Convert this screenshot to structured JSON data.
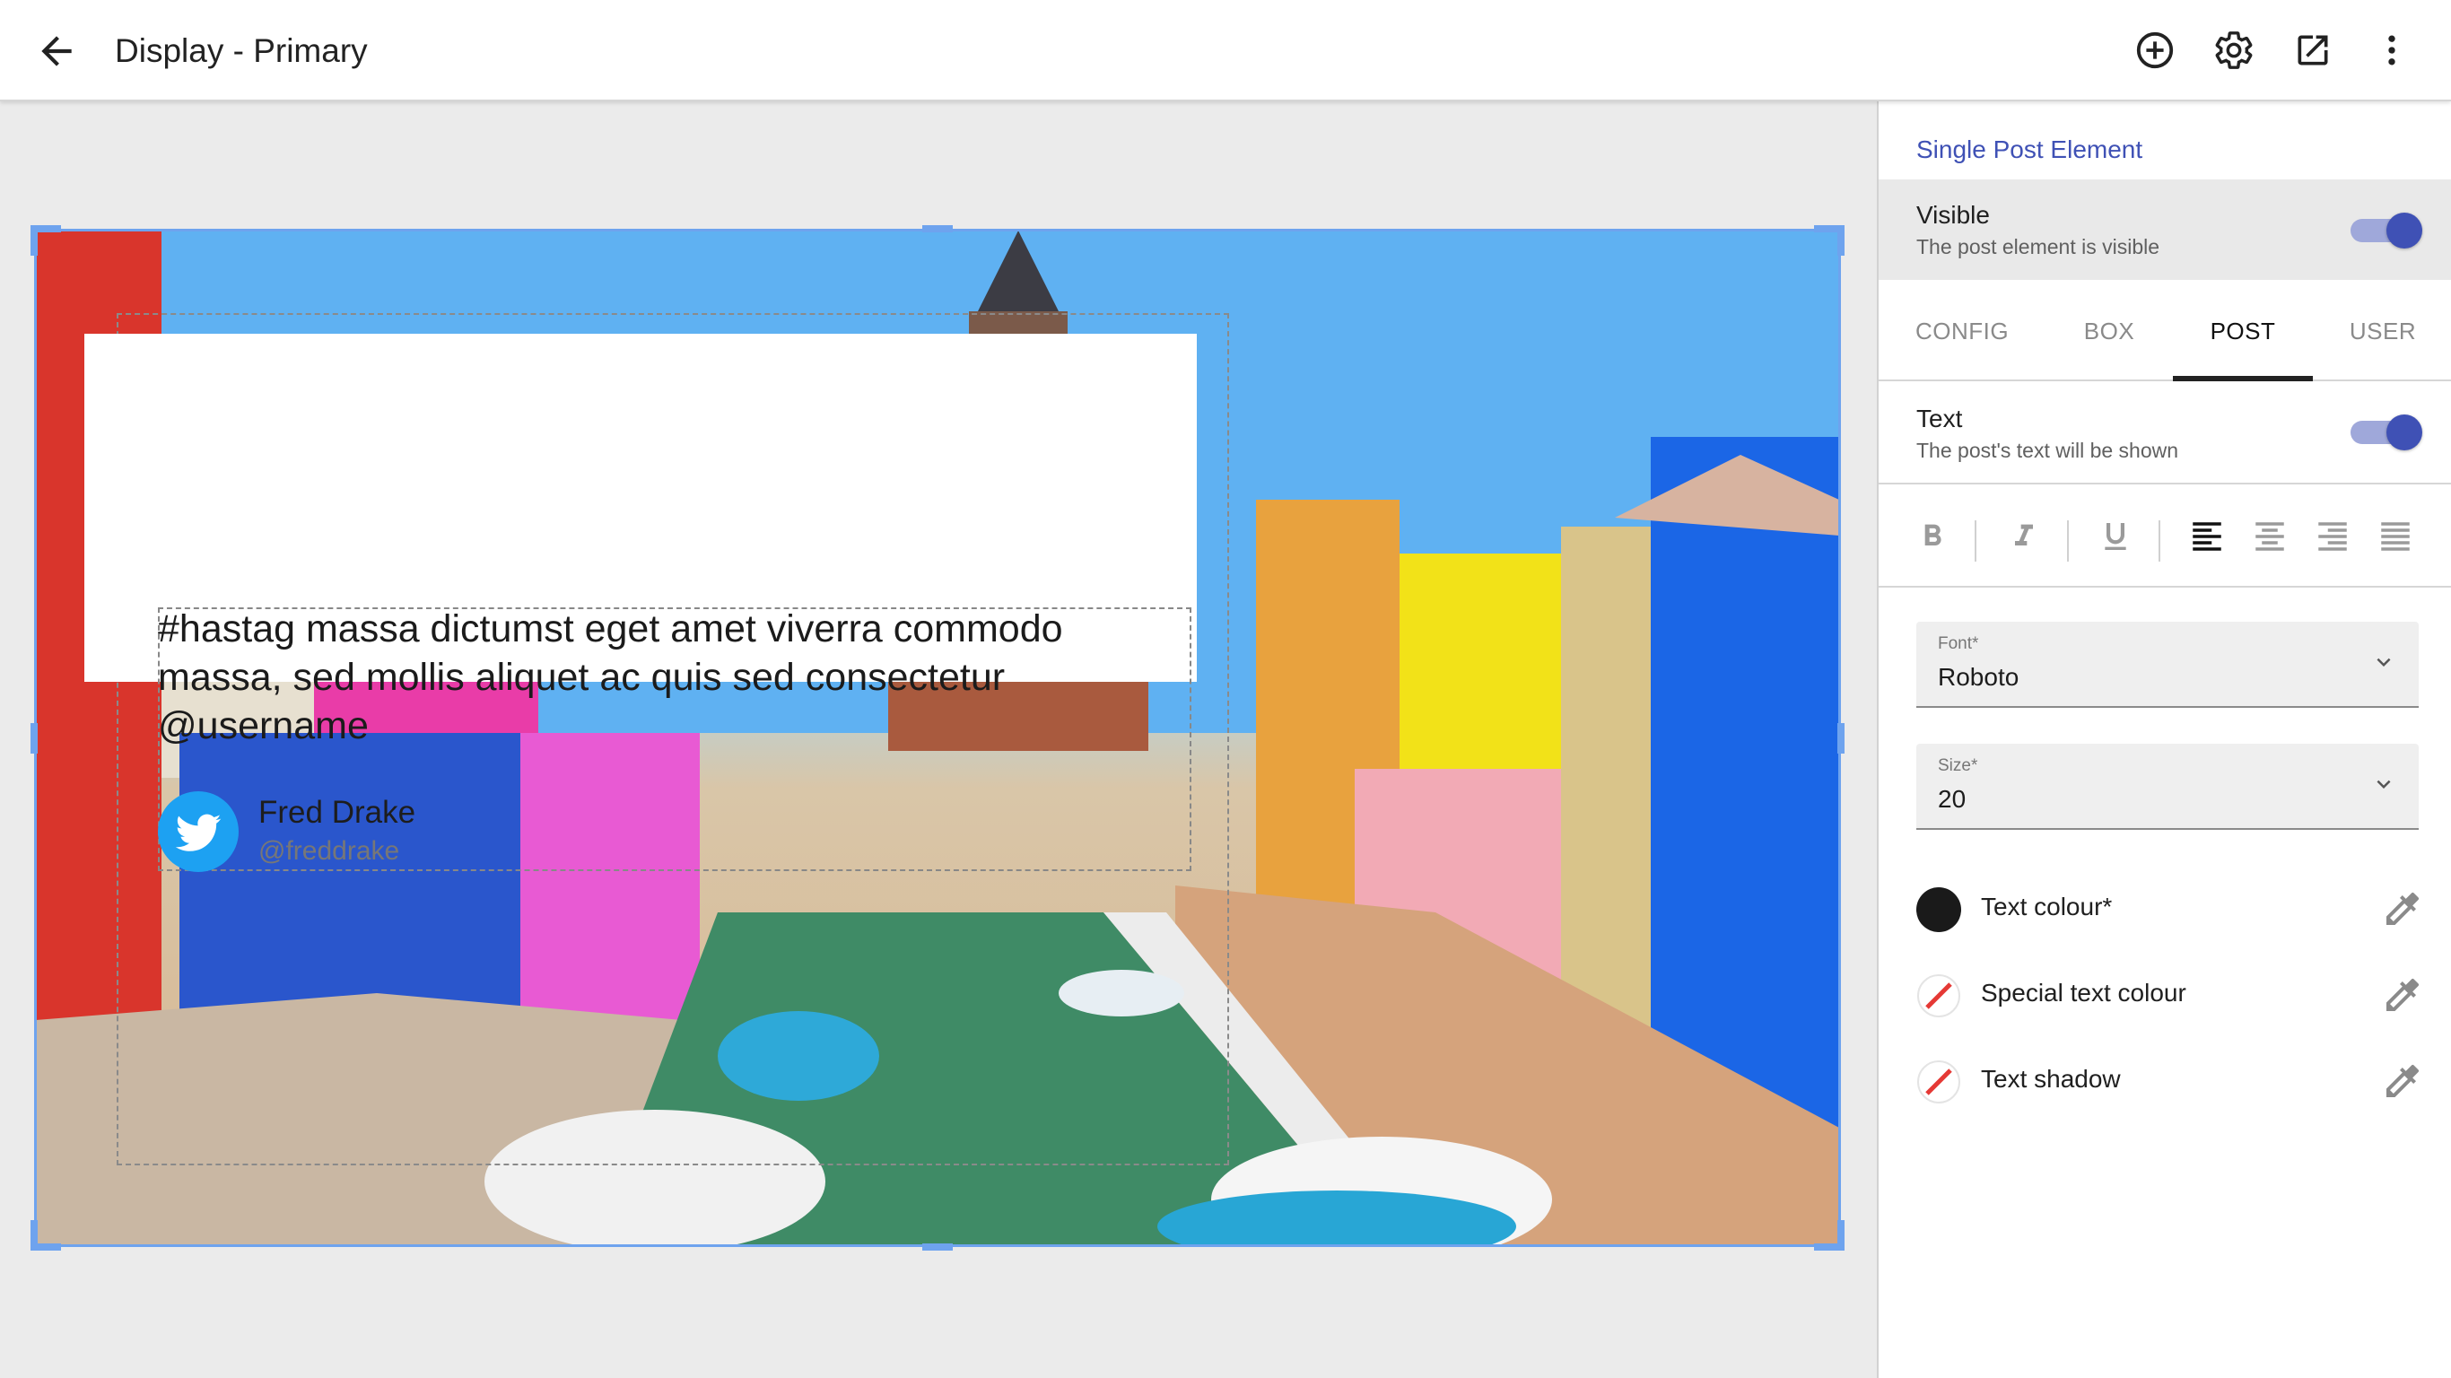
{
  "appbar": {
    "title": "Display - Primary",
    "actions": [
      "add-circle-icon",
      "settings-gear-icon",
      "open-in-new-icon",
      "more-vert-icon"
    ]
  },
  "post": {
    "text": "#hastag massa dictumst eget amet viverra commodo massa, sed mollis aliquet ac quis sed consectetur @username",
    "author_name": "Fred Drake",
    "author_handle": "@freddrake",
    "network_icon": "twitter-bird-icon"
  },
  "panel": {
    "title": "Single Post Element",
    "visible": {
      "title": "Visible",
      "subtitle": "The post element is visible",
      "on": true
    },
    "tabs": [
      {
        "label": "CONFIG",
        "active": false
      },
      {
        "label": "BOX",
        "active": false
      },
      {
        "label": "POST",
        "active": true
      },
      {
        "label": "USER",
        "active": false
      }
    ],
    "text_toggle": {
      "title": "Text",
      "subtitle": "The post's text will be shown",
      "on": true
    },
    "formatting": {
      "bold": false,
      "italic": false,
      "underline": false,
      "align": "left",
      "buttons": [
        "bold-icon",
        "italic-icon",
        "underline-icon",
        "align-left-icon",
        "align-center-icon",
        "align-right-icon",
        "align-justify-icon"
      ]
    },
    "font": {
      "label": "Font*",
      "value": "Roboto"
    },
    "size": {
      "label": "Size*",
      "value": "20"
    },
    "colors": [
      {
        "label": "Text colour*",
        "swatch": "#1a1a1a",
        "empty": false
      },
      {
        "label": "Special text colour",
        "swatch": "none",
        "empty": true
      },
      {
        "label": "Text shadow",
        "swatch": "none",
        "empty": true
      }
    ]
  },
  "colors": {
    "accent": "#3f51b5",
    "selection": "#6ea3ee",
    "twitter": "#1da1f2"
  }
}
